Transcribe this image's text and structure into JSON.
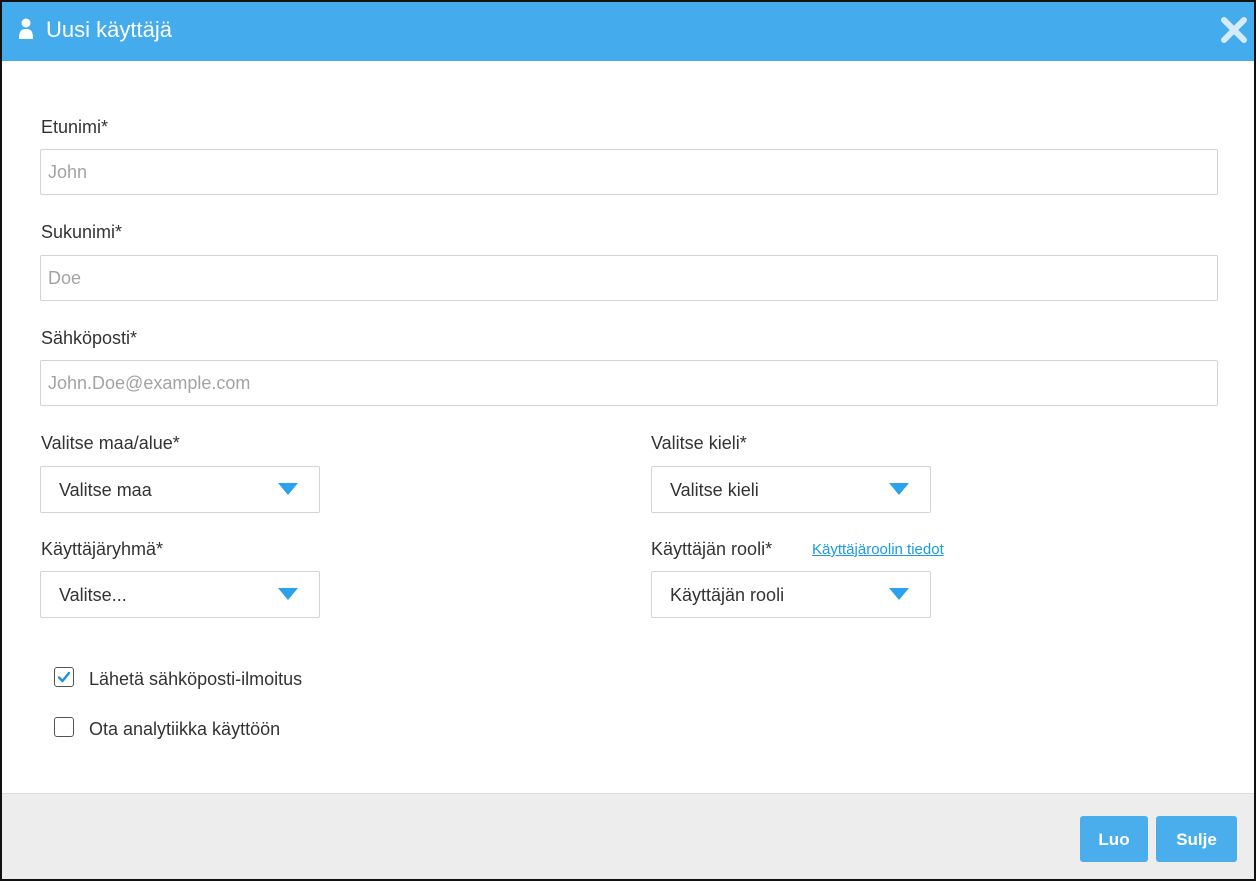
{
  "dialog": {
    "title": "Uusi käyttäjä",
    "title_icon": "user-icon",
    "close_icon": "close-icon",
    "accent_color": "#44abec"
  },
  "form": {
    "first_name": {
      "label": "Etunimi*",
      "placeholder": "John",
      "value": ""
    },
    "last_name": {
      "label": "Sukunimi*",
      "placeholder": "Doe",
      "value": ""
    },
    "email": {
      "label": "Sähköposti*",
      "placeholder": "John.Doe@example.com",
      "value": ""
    },
    "country": {
      "label": "Valitse maa/alue*",
      "selected": "Valitse maa"
    },
    "language": {
      "label": "Valitse kieli*",
      "selected": "Valitse kieli"
    },
    "user_group": {
      "label": "Käyttäjäryhmä*",
      "selected": "Valitse..."
    },
    "user_role": {
      "label": "Käyttäjän rooli*",
      "selected": "Käyttäjän rooli",
      "info_link": "Käyttäjäroolin tiedot"
    },
    "send_email": {
      "label": "Lähetä sähköposti-ilmoitus",
      "checked": true
    },
    "enable_analytics": {
      "label": "Ota analytiikka käyttöön",
      "checked": false
    }
  },
  "footer": {
    "create_label": "Luo",
    "close_label": "Sulje",
    "button_color": "#4aaeed"
  }
}
